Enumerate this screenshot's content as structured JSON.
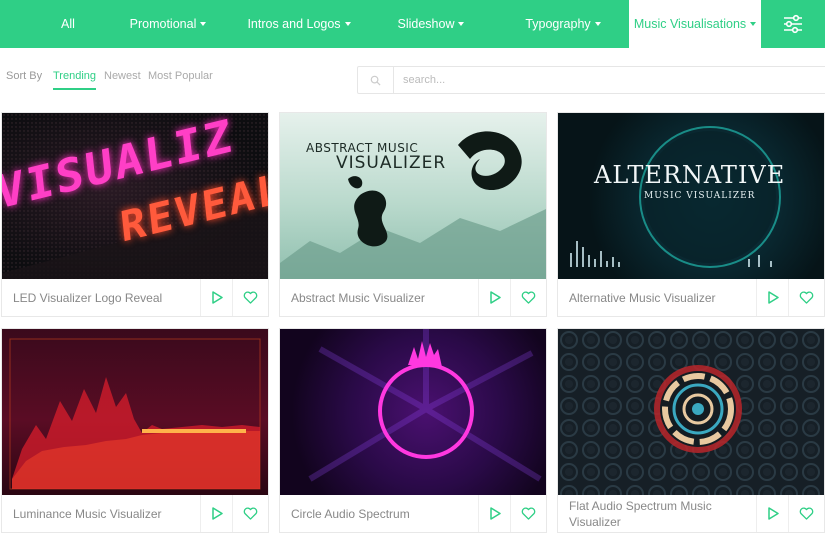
{
  "nav": {
    "items": [
      {
        "label": "All",
        "dropdown": false
      },
      {
        "label": "Promotional",
        "dropdown": true
      },
      {
        "label": "Intros and Logos",
        "dropdown": true
      },
      {
        "label": "Slideshow",
        "dropdown": true
      },
      {
        "label": "Typography",
        "dropdown": true
      },
      {
        "label": "Music Visualisations",
        "dropdown": true,
        "active": true
      }
    ],
    "filter_icon": "sliders-icon",
    "accent": "#2fcf86"
  },
  "sort": {
    "label": "Sort By",
    "options": [
      "Trending",
      "Newest",
      "Most Popular"
    ],
    "selected": "Trending"
  },
  "search": {
    "placeholder": "search...",
    "value": ""
  },
  "cards": [
    {
      "title": "LED Visualizer Logo Reveal",
      "thumb_text": [
        "VISUALIZ",
        "REVEAL"
      ]
    },
    {
      "title": "Abstract Music Visualizer",
      "thumb_text": [
        "ABSTRACT MUSIC",
        "VISUALIZER"
      ]
    },
    {
      "title": "Alternative Music Visualizer",
      "thumb_text": [
        "ALTERNATIVE",
        "MUSIC VISUALIZER"
      ]
    },
    {
      "title": "Luminance Music Visualizer",
      "thumb_text": []
    },
    {
      "title": "Circle Audio Spectrum",
      "thumb_text": []
    },
    {
      "title": "Flat Audio Spectrum Music Visualizer",
      "thumb_text": []
    }
  ]
}
